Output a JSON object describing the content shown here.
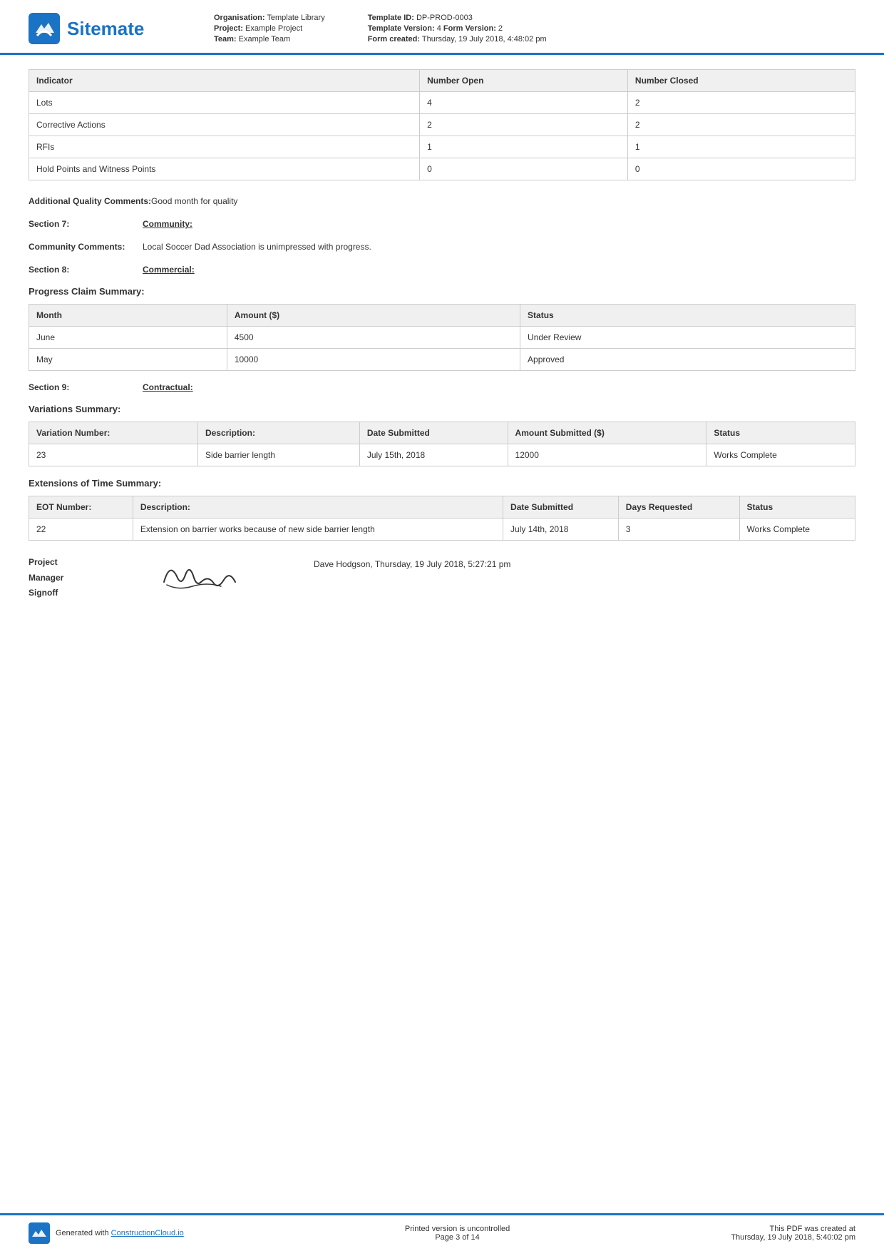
{
  "header": {
    "logo_text": "Sitemate",
    "org_label": "Organisation:",
    "org_value": "Template Library",
    "project_label": "Project:",
    "project_value": "Example Project",
    "team_label": "Team:",
    "team_value": "Example Team",
    "template_id_label": "Template ID:",
    "template_id_value": "DP-PROD-0003",
    "template_version_label": "Template Version:",
    "template_version_value": "4",
    "form_version_label": "Form Version:",
    "form_version_value": "2",
    "form_created_label": "Form created:",
    "form_created_value": "Thursday, 19 July 2018, 4:48:02 pm"
  },
  "summary_table": {
    "col1": "Indicator",
    "col2": "Number Open",
    "col3": "Number Closed",
    "rows": [
      {
        "indicator": "Lots",
        "open": "4",
        "closed": "2"
      },
      {
        "indicator": "Corrective Actions",
        "open": "2",
        "closed": "2"
      },
      {
        "indicator": "RFIs",
        "open": "1",
        "closed": "1"
      },
      {
        "indicator": "Hold Points and Witness Points",
        "open": "0",
        "closed": "0"
      }
    ]
  },
  "additional_quality": {
    "label": "Additional Quality Comments:",
    "value": "Good month for quality"
  },
  "section7": {
    "label": "Section 7:",
    "title": "Community:"
  },
  "community_comments": {
    "label": "Community Comments:",
    "value": "Local Soccer Dad Association is unimpressed with progress."
  },
  "section8": {
    "label": "Section 8:",
    "title": "Commercial:"
  },
  "progress_claim": {
    "title": "Progress Claim Summary:",
    "col1": "Month",
    "col2": "Amount ($)",
    "col3": "Status",
    "rows": [
      {
        "month": "June",
        "amount": "4500",
        "status": "Under Review"
      },
      {
        "month": "May",
        "amount": "10000",
        "status": "Approved"
      }
    ]
  },
  "section9": {
    "label": "Section 9:",
    "title": "Contractual:"
  },
  "variations": {
    "title": "Variations Summary:",
    "col1": "Variation Number:",
    "col2": "Description:",
    "col3": "Date Submitted",
    "col4": "Amount Submitted ($)",
    "col5": "Status",
    "rows": [
      {
        "number": "23",
        "description": "Side barrier length",
        "date": "July 15th, 2018",
        "amount": "12000",
        "status": "Works Complete"
      }
    ]
  },
  "eot": {
    "title": "Extensions of Time Summary:",
    "col1": "EOT Number:",
    "col2": "Description:",
    "col3": "Date Submitted",
    "col4": "Days Requested",
    "col5": "Status",
    "rows": [
      {
        "number": "22",
        "description": "Extension on barrier works because of new side barrier length",
        "date": "July 14th, 2018",
        "days": "3",
        "status": "Works Complete"
      }
    ]
  },
  "signoff": {
    "label_line1": "Project",
    "label_line2": "Manager",
    "label_line3": "Signoff",
    "meta": "Dave Hodgson, Thursday, 19 July 2018, 5:27:21 pm"
  },
  "footer": {
    "generated_text": "Generated with ",
    "link_text": "ConstructionCloud.io",
    "center_line1": "Printed version is uncontrolled",
    "center_line2": "Page 3 of 14",
    "right_line1": "This PDF was created at",
    "right_line2": "Thursday, 19 July 2018, 5:40:02 pm"
  }
}
